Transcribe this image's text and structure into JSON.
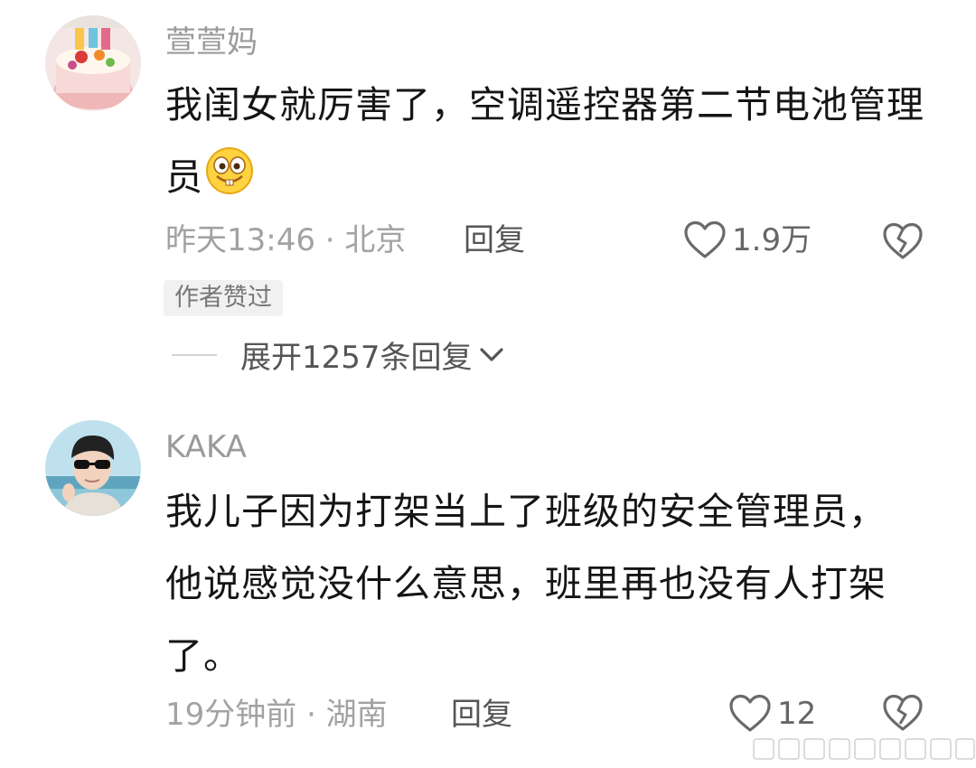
{
  "comments": [
    {
      "username": "萱萱妈",
      "content": "我闺女就厉害了，空调遥控器第二节电池管理员",
      "time_location": "昨天13:46 · 北京",
      "reply_label": "回复",
      "like_count": "1.9万",
      "badge": "作者赞过",
      "expand_replies": "展开1257条回复",
      "avatar_icon": "birthday-cake-avatar",
      "emoji_icon": "grinning-face-emoji"
    },
    {
      "username": "KAKA",
      "content": "我儿子因为打架当上了班级的安全管理员，他说感觉没什么意思，班里再也没有人打架了。",
      "time_location": "19分钟前 · 湖南",
      "reply_label": "回复",
      "like_count": "12",
      "avatar_icon": "person-with-sunglasses-avatar"
    }
  ],
  "icons": {
    "like": "heart-outline-icon",
    "dislike": "broken-heart-icon",
    "expand": "chevron-down-icon"
  }
}
